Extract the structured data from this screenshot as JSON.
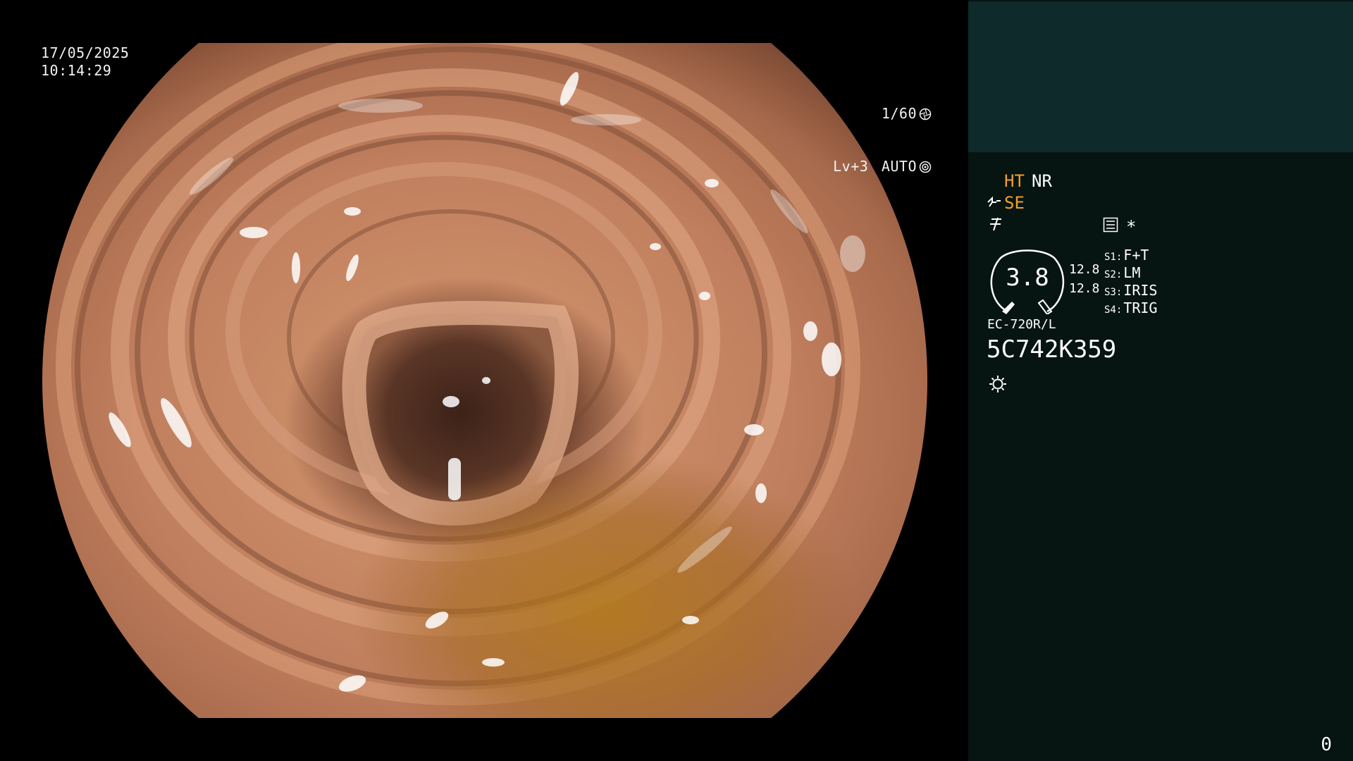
{
  "overlay": {
    "date": "17/05/2025",
    "time": "10:14:29",
    "shutter": "1/60",
    "level": "Lv+3",
    "iris_mode": "AUTO",
    "shutter_icon": "aperture-icon",
    "iris_icon": "iris-auto-icon"
  },
  "panel": {
    "ht": "HT",
    "nr": "NR",
    "se": "SE",
    "gauge_value": "3.8",
    "scale_top": "12.8",
    "scale_bottom": "12.8",
    "switches": [
      {
        "key": "S1:",
        "value": "F+T"
      },
      {
        "key": "S2:",
        "value": "LM"
      },
      {
        "key": "S3:",
        "value": "IRIS"
      },
      {
        "key": "S4:",
        "value": "TRIG"
      }
    ],
    "scope_model": "EC-720R/L",
    "serial": "5C742K359",
    "asterisk": "*",
    "page_counter": "0",
    "icons": [
      "signal-icon",
      "flex-icon",
      "menu-list-icon",
      "light-icon"
    ]
  },
  "colors": {
    "panel_background": "#061412",
    "panel_header": "#0e2a2a",
    "accent_orange": "#f2a028",
    "text": "#ffffff"
  }
}
